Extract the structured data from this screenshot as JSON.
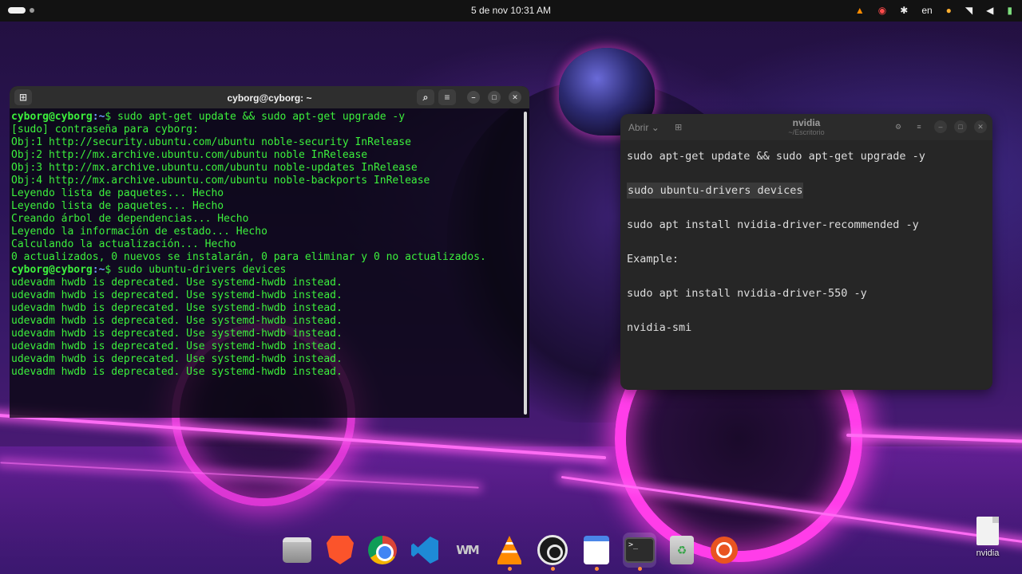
{
  "topbar": {
    "clock": "5 de nov  10:31 AM",
    "language": "en",
    "tray_icons": [
      "vlc-icon",
      "screen-record-icon",
      "accessibility-icon",
      "microphone-icon",
      "wifi-icon",
      "volume-icon",
      "battery-icon"
    ]
  },
  "terminal": {
    "title": "cyborg@cyborg: ~",
    "lines": [
      {
        "user": "cyborg@cyborg",
        "path": ":~",
        "cmd": "$ sudo apt-get update && sudo apt-get upgrade -y"
      },
      {
        "text": "[sudo] contraseña para cyborg:"
      },
      {
        "text": "Obj:1 http://security.ubuntu.com/ubuntu noble-security InRelease"
      },
      {
        "text": "Obj:2 http://mx.archive.ubuntu.com/ubuntu noble InRelease"
      },
      {
        "text": "Obj:3 http://mx.archive.ubuntu.com/ubuntu noble-updates InRelease"
      },
      {
        "text": "Obj:4 http://mx.archive.ubuntu.com/ubuntu noble-backports InRelease"
      },
      {
        "text": "Leyendo lista de paquetes... Hecho"
      },
      {
        "text": "Leyendo lista de paquetes... Hecho"
      },
      {
        "text": "Creando árbol de dependencias... Hecho"
      },
      {
        "text": "Leyendo la información de estado... Hecho"
      },
      {
        "text": "Calculando la actualización... Hecho"
      },
      {
        "text": "0 actualizados, 0 nuevos se instalarán, 0 para eliminar y 0 no actualizados."
      },
      {
        "user": "cyborg@cyborg",
        "path": ":~",
        "cmd": "$ sudo ubuntu-drivers devices"
      },
      {
        "text": "udevadm hwdb is deprecated. Use systemd-hwdb instead."
      },
      {
        "text": "udevadm hwdb is deprecated. Use systemd-hwdb instead."
      },
      {
        "text": "udevadm hwdb is deprecated. Use systemd-hwdb instead."
      },
      {
        "text": "udevadm hwdb is deprecated. Use systemd-hwdb instead."
      },
      {
        "text": "udevadm hwdb is deprecated. Use systemd-hwdb instead."
      },
      {
        "text": "udevadm hwdb is deprecated. Use systemd-hwdb instead."
      },
      {
        "text": "udevadm hwdb is deprecated. Use systemd-hwdb instead."
      },
      {
        "text": "udevadm hwdb is deprecated. Use systemd-hwdb instead."
      }
    ]
  },
  "editor": {
    "open_label": "Abrir",
    "title": "nvidia",
    "subtitle": "~/Escritorio",
    "lines": [
      {
        "text": "sudo apt-get update && sudo apt-get upgrade -y",
        "highlight": false
      },
      {
        "text": "sudo ubuntu-drivers devices",
        "highlight": true
      },
      {
        "text": "sudo apt install nvidia-driver-recommended -y",
        "highlight": false
      },
      {
        "text": "Example:",
        "highlight": false
      },
      {
        "text": "sudo apt install nvidia-driver-550 -y",
        "highlight": false
      },
      {
        "text": "nvidia-smi",
        "highlight": false
      }
    ]
  },
  "dock": {
    "apps": [
      {
        "name": "files",
        "icon": "files-icon"
      },
      {
        "name": "brave",
        "icon": "brave-icon"
      },
      {
        "name": "chrome",
        "icon": "chrome-icon"
      },
      {
        "name": "vscode",
        "icon": "vscode-icon"
      },
      {
        "name": "wm",
        "icon": "wm-app-icon"
      },
      {
        "name": "vlc",
        "icon": "vlc-icon"
      },
      {
        "name": "obs",
        "icon": "obs-icon"
      },
      {
        "name": "text-editor",
        "icon": "text-editor-icon"
      },
      {
        "name": "terminal",
        "icon": "terminal-icon"
      },
      {
        "name": "trash",
        "icon": "trash-icon"
      },
      {
        "name": "show-apps",
        "icon": "ubuntu-icon"
      }
    ],
    "wm_label": "WM",
    "terminal_glyph": ">_"
  },
  "desktop": {
    "file_label": "nvidia"
  },
  "colors": {
    "terminal_text": "#3cf03c",
    "prompt_path": "#6f9bff",
    "neon": "#ff3de9",
    "ubuntu_orange": "#e95420"
  }
}
